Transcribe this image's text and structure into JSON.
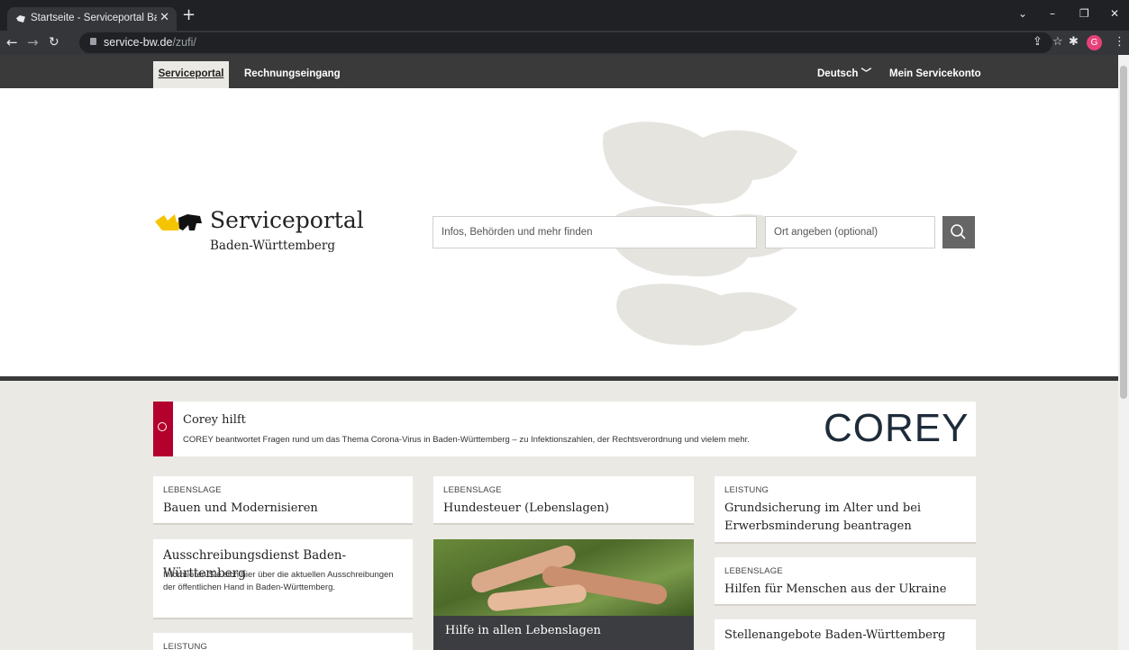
{
  "browser": {
    "tab_title": "Startseite - Serviceportal Baden-W",
    "url_host": "service-bw.de",
    "url_path": "/zufi/",
    "avatar_letter": "G"
  },
  "site_nav": {
    "tabs": [
      {
        "label": "Serviceportal",
        "active": true
      },
      {
        "label": "Rechnungseingang",
        "active": false
      }
    ],
    "language": "Deutsch",
    "account": "Mein Servicekonto"
  },
  "hero": {
    "logo_title": "Serviceportal",
    "logo_subtitle": "Baden-Württemberg",
    "search_placeholder": "Infos, Behörden und mehr finden",
    "location_placeholder": "Ort angeben (optional)"
  },
  "corey": {
    "title": "Corey hilft",
    "description": "COREY beantwortet Fragen rund um das Thema Corona-Virus in Baden-Württemberg – zu Infektionszahlen, der Rechtsverordnung und vielem mehr.",
    "brand": "COREY"
  },
  "cards": {
    "c1": {
      "kicker": "LEBENSLAGE",
      "title": "Bauen und Modernisieren"
    },
    "c2": {
      "kicker": "LEBENSLAGE",
      "title": "Hundesteuer (Lebenslagen)"
    },
    "c3": {
      "kicker": "LEISTUNG",
      "title_line1": "Grundsicherung im Alter und bei",
      "title_line2": "Erwerbsminderung beantragen"
    },
    "c4": {
      "title": "Ausschreibungsdienst Baden-Württemberg",
      "text": "Informieren Sie sich hier über die aktuellen Ausschreibungen der öffentlichen Hand in Baden-Württemberg."
    },
    "c5": {
      "caption": "Hilfe in allen Lebenslagen"
    },
    "c6": {
      "kicker": "LEBENSLAGE",
      "title": "Hilfen für Menschen aus der Ukraine"
    },
    "c7": {
      "kicker": "LEISTUNG"
    },
    "c8": {
      "title": "Stellenangebote Baden-Württemberg"
    }
  },
  "colors": {
    "accent_red": "#b3002d",
    "nav_dark": "#3a3a3a",
    "content_bg": "#ebe9e4"
  },
  "icons": [
    "search-icon",
    "info-icon",
    "chevron-down-icon",
    "lion-emblem-icon"
  ]
}
